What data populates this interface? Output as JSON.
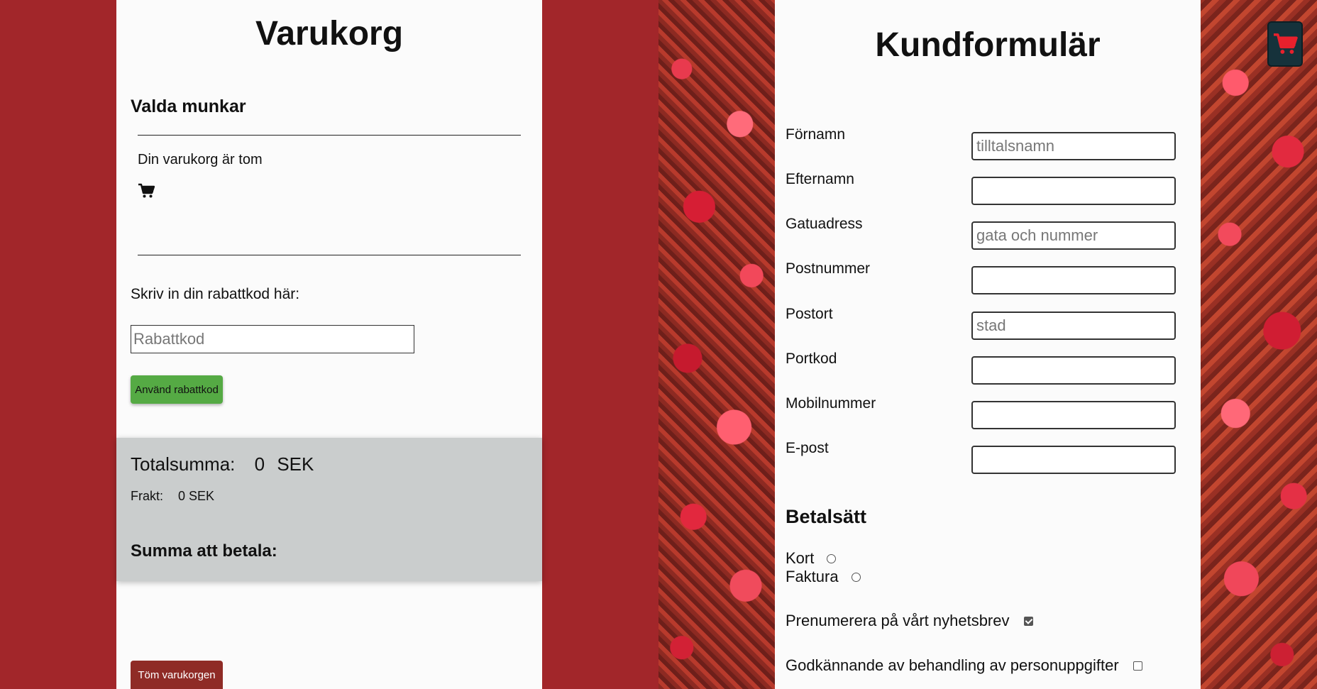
{
  "cart": {
    "title": "Varukorg",
    "subtitle": "Valda munkar",
    "empty_text": "Din varukorg är tom",
    "discount_label": "Skriv in din rabattkod här:",
    "discount_placeholder": "Rabattkod",
    "discount_button": "Använd rabattkod",
    "total_label": "Totalsumma:",
    "total_value": "0",
    "total_currency": "SEK",
    "freight_label": "Frakt:",
    "freight_value": "0 SEK",
    "pay_sum_label": "Summa att betala:",
    "clear_button": "Töm varukorgen",
    "icons": {
      "cart": "shopping-cart-icon"
    }
  },
  "form": {
    "title": "Kundformulär",
    "fields": [
      {
        "label": "Förnamn",
        "placeholder": "tilltalsnamn",
        "value": ""
      },
      {
        "label": "Efternamn",
        "placeholder": "",
        "value": ""
      },
      {
        "label": "Gatuadress",
        "placeholder": "gata och nummer",
        "value": ""
      },
      {
        "label": "Postnummer",
        "placeholder": "",
        "value": ""
      },
      {
        "label": "Postort",
        "placeholder": "stad",
        "value": ""
      },
      {
        "label": "Portkod",
        "placeholder": "",
        "value": ""
      },
      {
        "label": "Mobilnummer",
        "placeholder": "",
        "value": ""
      },
      {
        "label": "E-post",
        "placeholder": "",
        "value": ""
      }
    ],
    "payment_heading": "Betalsätt",
    "payment_options": [
      {
        "label": "Kort",
        "selected": false
      },
      {
        "label": "Faktura",
        "selected": false
      }
    ],
    "newsletter_label": "Prenumerera på vårt nyhetsbrev",
    "newsletter_checked": true,
    "consent_label": "Godkännande av behandling av personuppgifter",
    "consent_checked": false
  },
  "colors": {
    "background": "#a2262a",
    "discount_button": "#55aa44",
    "clear_button": "#8f2b26",
    "summary_box": "#cacdcd",
    "cart_button_bg": "#16323b",
    "cart_button_icon": "#e8202c"
  }
}
